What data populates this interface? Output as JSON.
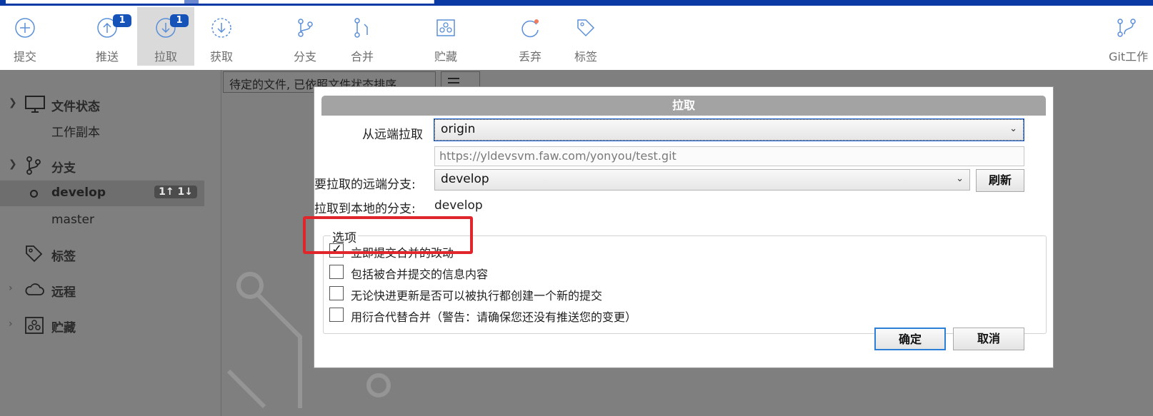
{
  "toolbar": {
    "buttons": [
      {
        "label": "提交",
        "icon": "plus-circle-icon"
      },
      {
        "label": "推送",
        "icon": "arrow-up-circle-icon",
        "badge": "1"
      },
      {
        "label": "拉取",
        "icon": "arrow-down-circle-icon",
        "badge": "1"
      },
      {
        "label": "获取",
        "icon": "dashed-arrow-down-icon"
      },
      {
        "label": "分支",
        "icon": "branch-icon"
      },
      {
        "label": "合并",
        "icon": "merge-icon"
      },
      {
        "label": "贮藏",
        "icon": "stash-icon"
      },
      {
        "label": "丢弃",
        "icon": "discard-icon"
      },
      {
        "label": "标签",
        "icon": "tag-icon"
      },
      {
        "label": "Git工作",
        "icon": "git-flow-icon"
      }
    ]
  },
  "sidebar": {
    "file_status": "文件状态",
    "working_copy": "工作副本",
    "branches": "分支",
    "develop": "develop",
    "develop_count": "1↑ 1↓",
    "master": "master",
    "tags": "标签",
    "remotes": "远程",
    "stashes": "贮藏"
  },
  "filelist": {
    "sort_select": "待定的文件, 已依照文件状态排序"
  },
  "dialog": {
    "title": "拉取",
    "remote_label": "从远端拉取",
    "remote_value": "origin",
    "remote_url": "https://yldevsvm.faw.com/yonyou/test.git",
    "remote_branch_label": "要拉取的远端分支:",
    "remote_branch_value": "develop",
    "refresh": "刷新",
    "local_branch_label": "拉取到本地的分支:",
    "local_branch_value": "develop",
    "options_label": "选项",
    "options": [
      {
        "label": "立即提交合并的改动",
        "checked": true
      },
      {
        "label": "包括被合并提交的信息内容",
        "checked": false
      },
      {
        "label": "无论快进更新是否可以被执行都创建一个新的提交",
        "checked": false
      },
      {
        "label": "用衍合代替合并（警告：请确保您还没有推送您的变更）",
        "checked": false
      }
    ],
    "ok": "确定",
    "cancel": "取消"
  },
  "colors": {
    "accent": "#1553b8",
    "highlight": "#e0262a",
    "background_dim": "#7f7f7f"
  }
}
